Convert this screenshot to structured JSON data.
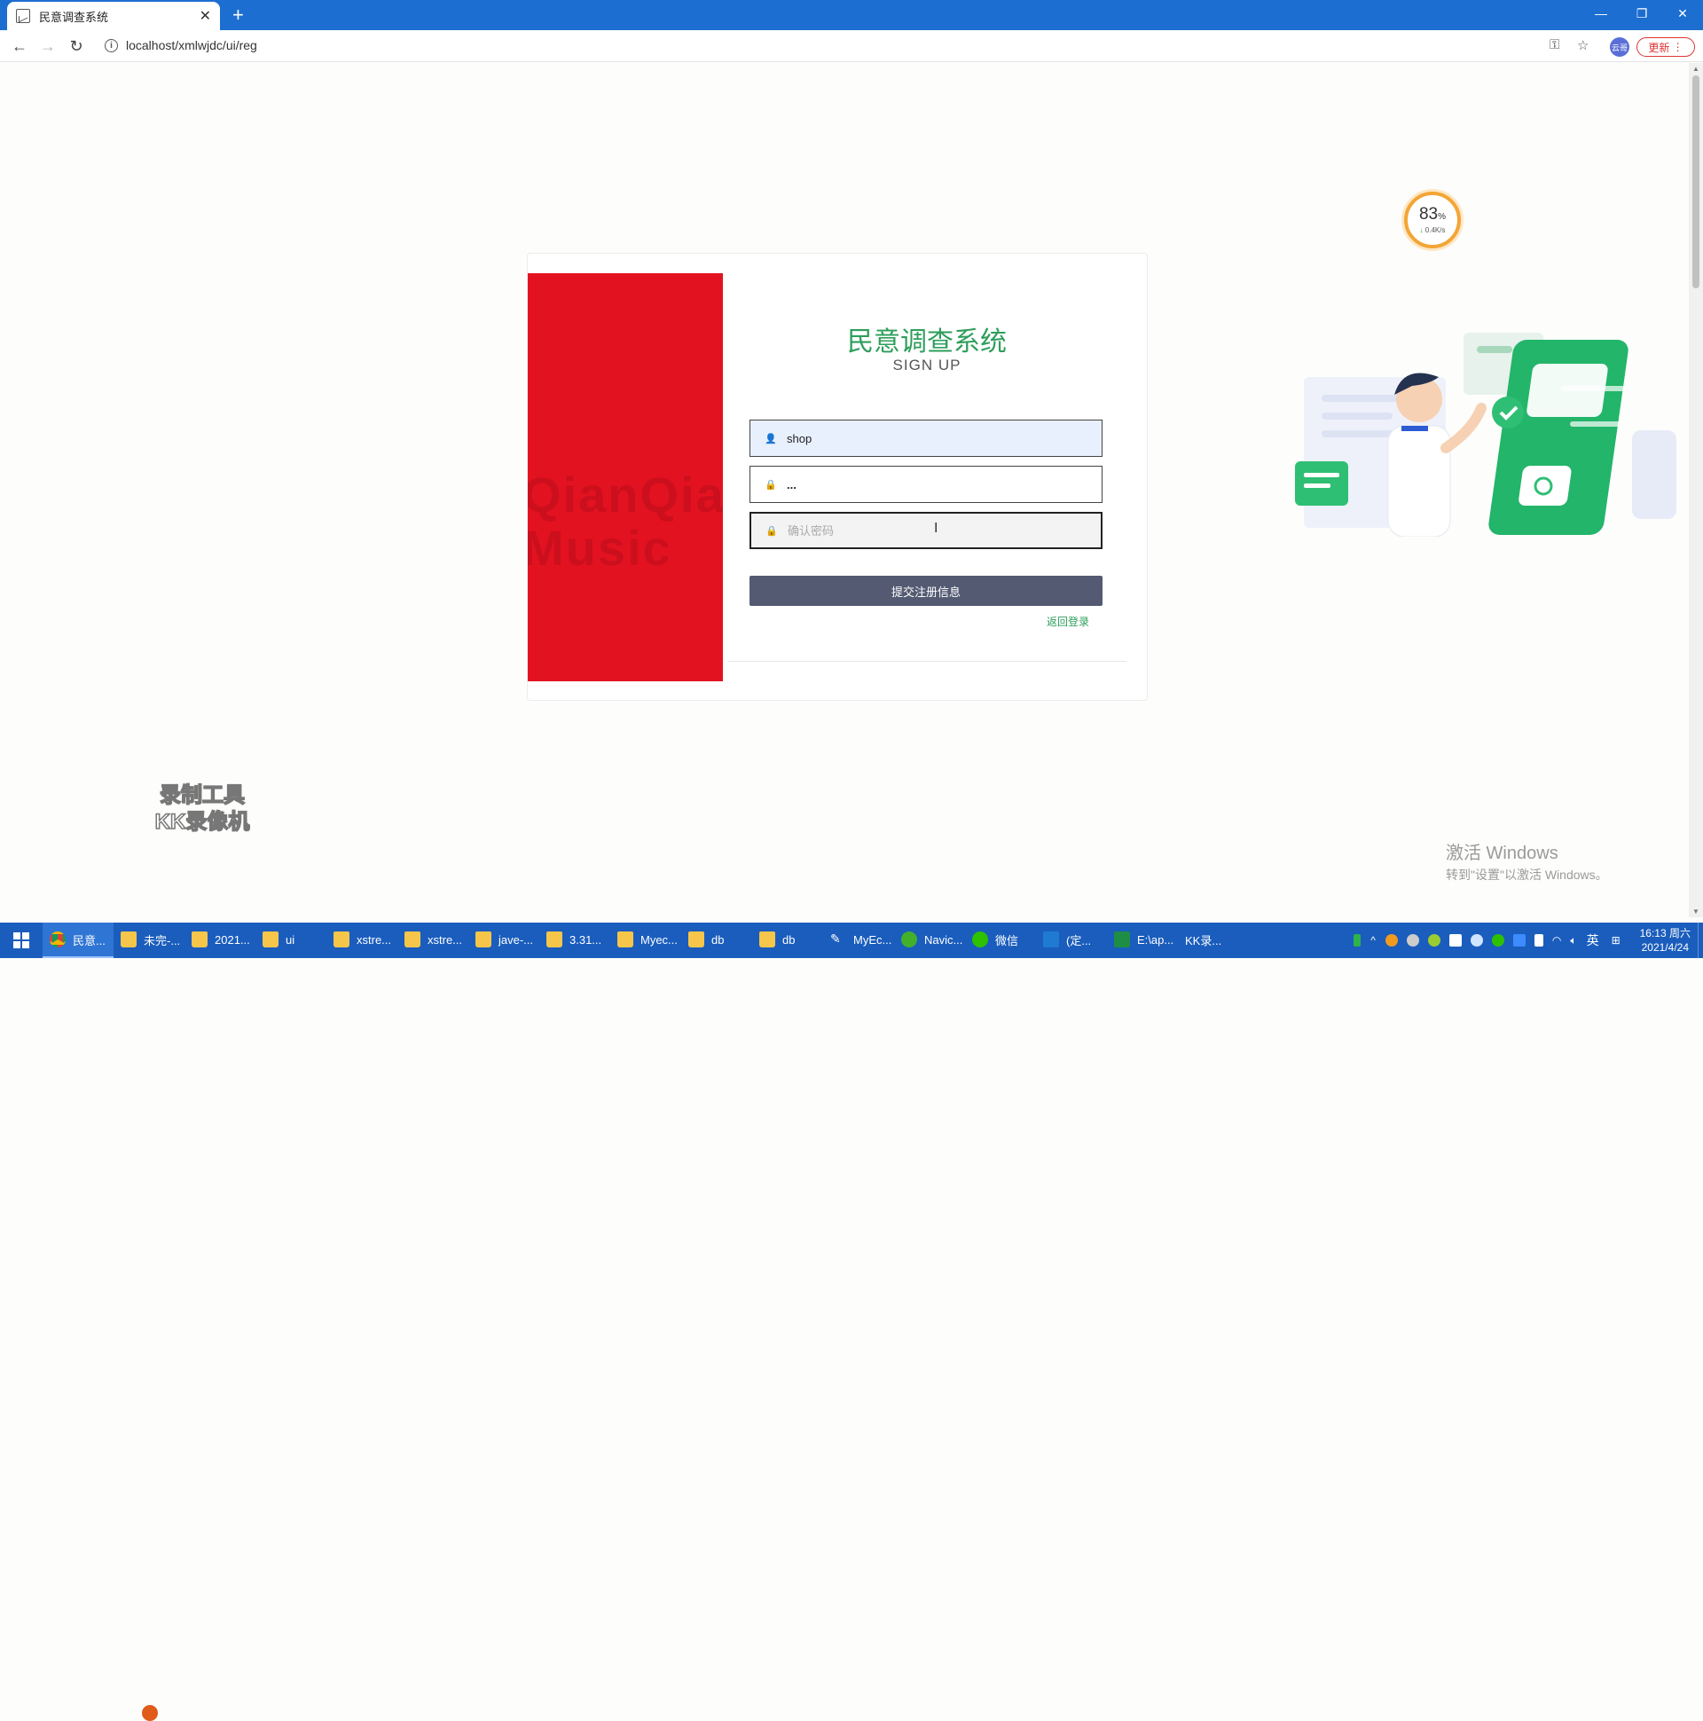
{
  "browser": {
    "tab_title": "民意调查系统",
    "new_tab": "+",
    "url": "localhost/xmlwjdc/ui/reg",
    "profile_label": "云哥",
    "update_label": "更新"
  },
  "form": {
    "title": "民意调查系统",
    "subtitle": "SIGN UP",
    "username_value": "shop",
    "password_value": "...",
    "confirm_placeholder": "确认密码",
    "submit_label": "提交注册信息",
    "back_label": "返回登录"
  },
  "speed_widget": {
    "percent": "83",
    "percent_unit": "%",
    "rate": "0.4K/s"
  },
  "red_panel_text": "QianQia\nMusic",
  "watermark": {
    "kk_line1": "录制工具",
    "kk_line2": "KK录像机",
    "activate_line1": "激活 Windows",
    "activate_line2": "转到\"设置\"以激活 Windows。"
  },
  "taskbar": {
    "items": [
      {
        "label": "民意...",
        "icon": "chrome-icon",
        "active": true
      },
      {
        "label": "未完-...",
        "icon": "folder-icon"
      },
      {
        "label": "2021...",
        "icon": "folder-icon"
      },
      {
        "label": "ui",
        "icon": "folder-icon"
      },
      {
        "label": "xstre...",
        "icon": "folder-icon"
      },
      {
        "label": "xstre...",
        "icon": "folder-icon"
      },
      {
        "label": "jave-...",
        "icon": "folder-icon"
      },
      {
        "label": "3.31...",
        "icon": "folder-icon"
      },
      {
        "label": "Myec...",
        "icon": "folder-icon"
      },
      {
        "label": "db",
        "icon": "folder-icon"
      },
      {
        "label": "db",
        "icon": "folder-icon"
      },
      {
        "label": "MyEc...",
        "icon": "feather-icon"
      },
      {
        "label": "Navic...",
        "icon": "navicat-icon"
      },
      {
        "label": "微信",
        "icon": "wechat-icon"
      },
      {
        "label": "(定...",
        "icon": "vs-icon"
      },
      {
        "label": "E:\\ap...",
        "icon": "excel-icon"
      },
      {
        "label": "KK录...",
        "icon": "kk-icon"
      }
    ],
    "ime": "英",
    "time": "16:13 周六",
    "date": "2021/4/24"
  },
  "colors": {
    "accent_green": "#2e9e5b",
    "red_panel": "#e31221",
    "submit_bg": "#535a72",
    "titlebar": "#1c6ed0"
  }
}
